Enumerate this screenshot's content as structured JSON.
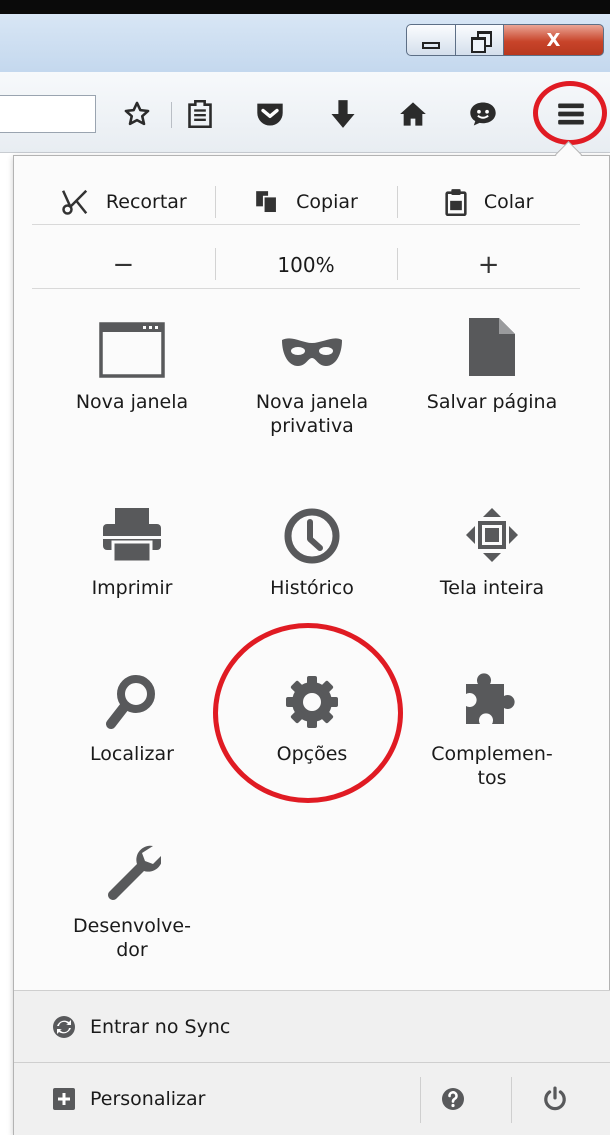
{
  "window": {
    "close_glyph": "X"
  },
  "toolbar": {
    "icons": [
      "bookmark-star-icon",
      "reading-list-icon",
      "pocket-icon",
      "download-icon",
      "home-icon",
      "chat-icon",
      "hamburger-menu-icon"
    ]
  },
  "menu": {
    "edit": {
      "cut": "Recortar",
      "copy": "Copiar",
      "paste": "Colar"
    },
    "zoom": {
      "minus": "−",
      "level": "100%",
      "plus": "+"
    },
    "tiles": {
      "new_window": "Nova janela",
      "private_window": "Nova janela privativa",
      "save_page": "Salvar página",
      "print": "Imprimir",
      "history": "Histórico",
      "fullscreen": "Tela inteira",
      "find": "Localizar",
      "options": "Opções",
      "addons": "Complemen-tos",
      "developer": "Desenvolve-dor"
    },
    "footer": {
      "sync": "Entrar no Sync",
      "customize": "Personalizar"
    }
  },
  "colors": {
    "highlight_ring": "#e01b23",
    "icon_gray": "#58595b",
    "panel_bg": "#fbfbfb",
    "footer_bg": "#f0f0f0"
  }
}
